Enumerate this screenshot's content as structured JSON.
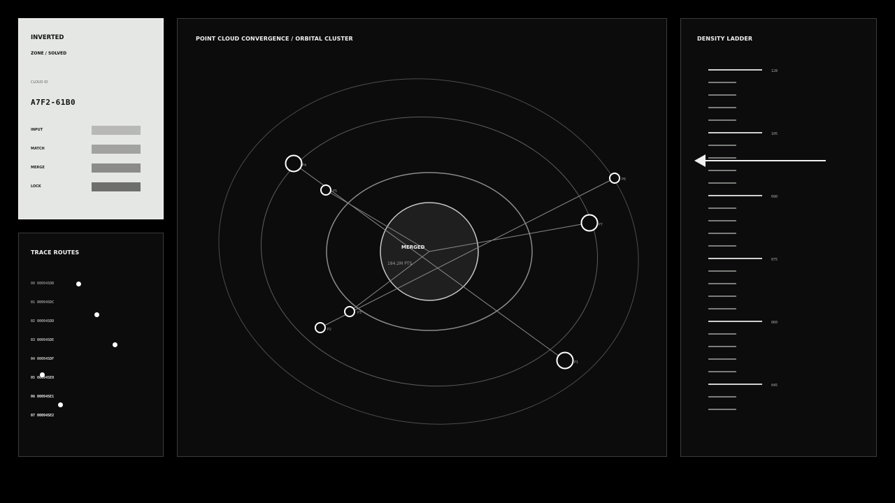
{
  "status": {
    "mode": "INVERTED",
    "zone": "ZONE / SOLVED",
    "cloud_id_label": "CLOUD ID",
    "cloud_id": "A7F2-61B0",
    "stages": [
      {
        "label": "INPUT",
        "color": "#b8b9b7"
      },
      {
        "label": "MATCH",
        "color": "#a2a3a1"
      },
      {
        "label": "MERGE",
        "color": "#8b8c8a"
      },
      {
        "label": "LOCK",
        "color": "#6e6f6d"
      }
    ]
  },
  "trace": {
    "title": "TRACE ROUTES",
    "routes": [
      {
        "text": "00 00094SDB",
        "color": "#8a8c8a"
      },
      {
        "text": "01 00094SDC",
        "color": "#9a9c9a"
      },
      {
        "text": "02 00094SDD",
        "color": "#aaacaa"
      },
      {
        "text": "03 00094SDE",
        "color": "#bcbebc"
      },
      {
        "text": "04 00094SDF",
        "color": "#ccceca"
      },
      {
        "text": "05 00094SE0",
        "color": "#dcdedc"
      },
      {
        "text": "06 00094SE1",
        "color": "#eaeaea"
      },
      {
        "text": "07 00094SE2",
        "color": "#f4f4f4"
      }
    ]
  },
  "main": {
    "title": "POINT CLOUD CONVERGENCE / ORBITAL CLUSTER",
    "core_label": "MERGED",
    "core_points": "184.2M PTS",
    "nodes": [
      {
        "label": "P1",
        "big": true
      },
      {
        "label": "P2",
        "big": false
      },
      {
        "label": "P3",
        "big": false
      },
      {
        "label": "P4",
        "big": true
      },
      {
        "label": "P5",
        "big": false
      },
      {
        "label": "P6",
        "big": false
      },
      {
        "label": "P7",
        "big": true
      }
    ]
  },
  "ladder": {
    "title": "DENSITY LADDER",
    "labels": [
      "128",
      "105",
      "090",
      "075",
      "060",
      "045"
    ]
  }
}
